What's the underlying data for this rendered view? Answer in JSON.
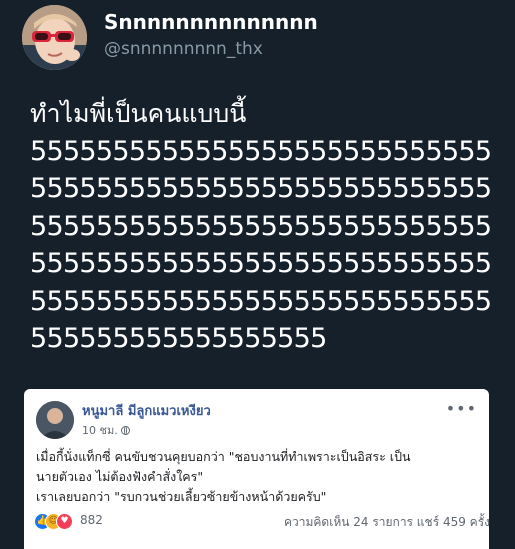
{
  "tweet": {
    "display_name": "Snnnnnnnnnnnnnn",
    "handle": "@snnnnnnnnn_thx",
    "lines": [
      "ทำไมพี่เป็นคนแบบนี้",
      "5555555555555555555555555555",
      "5555555555555555555555555555",
      "5555555555555555555555555555",
      "5555555555555555555555555555",
      "5555555555555555555555555555",
      "555555555555555555"
    ]
  },
  "facebook_post": {
    "author": "หนูมาลี มีลูกแมวเหงียว",
    "time": "10 ชม.",
    "text_lines": [
      "เมื่อกี้นั่งแท็กซี่ คนขับชวนคุยบอกว่า \"ชอบงานที่ทำเพราะเป็นอิสระ เป็น",
      "นายตัวเอง ไม่ต้องฟังคำสั่งใคร\"",
      "เราเลยบอกว่า \"รบกวนช่วยเลี้ยวซ้ายข้างหน้าด้วยครับ\""
    ],
    "reaction_count": "882",
    "comments_shares": "ความคิดเห็น 24 รายการ  แชร์ 459 ครั้ง"
  },
  "colors": {
    "background": "#15202b",
    "tweet_text": "#ffffff",
    "handle": "#8899a6",
    "fb_name": "#385898",
    "fb_like": "#1877f2"
  },
  "icons": [
    "profile-avatar",
    "globe-icon",
    "more-options-icon",
    "like-reaction-icon",
    "haha-reaction-icon",
    "love-reaction-icon"
  ]
}
